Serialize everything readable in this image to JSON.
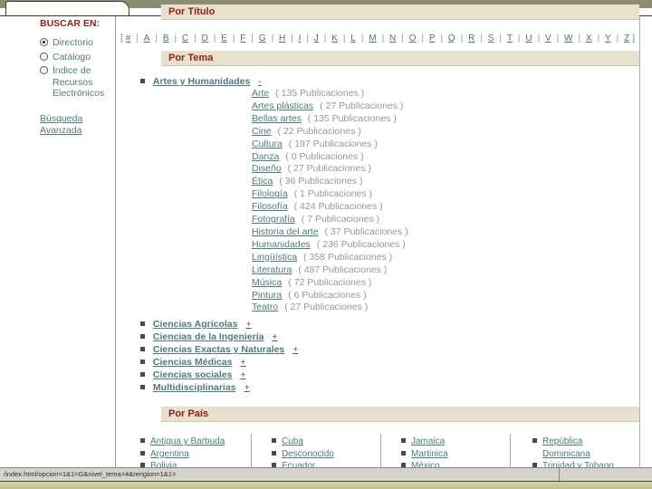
{
  "window": {
    "status_url": "/index.html/opcion=1&1=G&nivel_tema=4&renglon=1&1="
  },
  "sidebar": {
    "title": "BUSCAR EN:",
    "options": [
      {
        "label": "Directorio",
        "selected": true
      },
      {
        "label": "Catálogo",
        "selected": false
      },
      {
        "label": "Índice de Recursos Electrónicos",
        "selected": false
      }
    ],
    "advanced_search_label": "Búsqueda Avanzada"
  },
  "sections": {
    "by_title": "Por Título",
    "by_theme": "Por Tema",
    "by_country": "Por País"
  },
  "alphabet_open": "[",
  "alphabet_close": "]",
  "alphabet_separator": "|",
  "alphabet": [
    "#",
    "A",
    "B",
    "C",
    "D",
    "E",
    "F",
    "G",
    "H",
    "I",
    "J",
    "K",
    "L",
    "M",
    "N",
    "O",
    "P",
    "Q",
    "R",
    "S",
    "T",
    "U",
    "V",
    "W",
    "X",
    "Y",
    "Z"
  ],
  "themes": {
    "expanded": {
      "label": "Artes y Humanidades",
      "toggle": "-"
    },
    "subtopics": [
      {
        "label": "Arte",
        "count": "( 135 Publicaciones )"
      },
      {
        "label": "Artes plásticas",
        "count": "( 27 Publicaciones )"
      },
      {
        "label": "Bellas artes",
        "count": "( 135 Publicaciones )"
      },
      {
        "label": "Cine",
        "count": "( 22 Publicaciones )"
      },
      {
        "label": "Cultura",
        "count": "( 197 Publicaciones )"
      },
      {
        "label": "Danza",
        "count": "( 0 Publicaciones )"
      },
      {
        "label": "Diseño",
        "count": "( 27 Publicaciones )"
      },
      {
        "label": "Ética",
        "count": "( 36 Publicaciones )"
      },
      {
        "label": "Filología",
        "count": "( 1 Publicaciones )"
      },
      {
        "label": "Filosofía",
        "count": "( 424 Publicaciones )"
      },
      {
        "label": "Fotografía",
        "count": "( 7 Publicaciones )"
      },
      {
        "label": "Historia del arte",
        "count": "( 37 Publicaciones )"
      },
      {
        "label": "Humanidades",
        "count": "( 236 Publicaciones )"
      },
      {
        "label": "Lingüística",
        "count": "( 358 Publicaciones )"
      },
      {
        "label": "Literatura",
        "count": "( 487 Publicaciones )"
      },
      {
        "label": "Música",
        "count": "( 72 Publicaciones )"
      },
      {
        "label": "Pintura",
        "count": "( 6 Publicaciones )"
      },
      {
        "label": "Teatro",
        "count": "( 27 Publicaciones )"
      }
    ],
    "collapsed": [
      {
        "label": "Ciencias Agrícolas",
        "toggle": "+"
      },
      {
        "label": "Ciencias de la Ingeniería",
        "toggle": "+"
      },
      {
        "label": "Ciencias Exactas y Naturales",
        "toggle": "+"
      },
      {
        "label": "Ciencias Médicas",
        "toggle": "+"
      },
      {
        "label": "Ciencias sociales",
        "toggle": "+"
      },
      {
        "label": "Multidisciplinarias",
        "toggle": "+"
      }
    ]
  },
  "countries": {
    "col1": [
      "Antigua y Barbuda",
      "Argentina",
      "Bolivia"
    ],
    "col2": [
      "Cuba",
      "Desconocido",
      "Ecuador"
    ],
    "col3": [
      "Jamaica",
      "Martinica",
      "México"
    ],
    "col4": [
      "República Dominicana",
      "Trinidad y Tobago"
    ]
  }
}
